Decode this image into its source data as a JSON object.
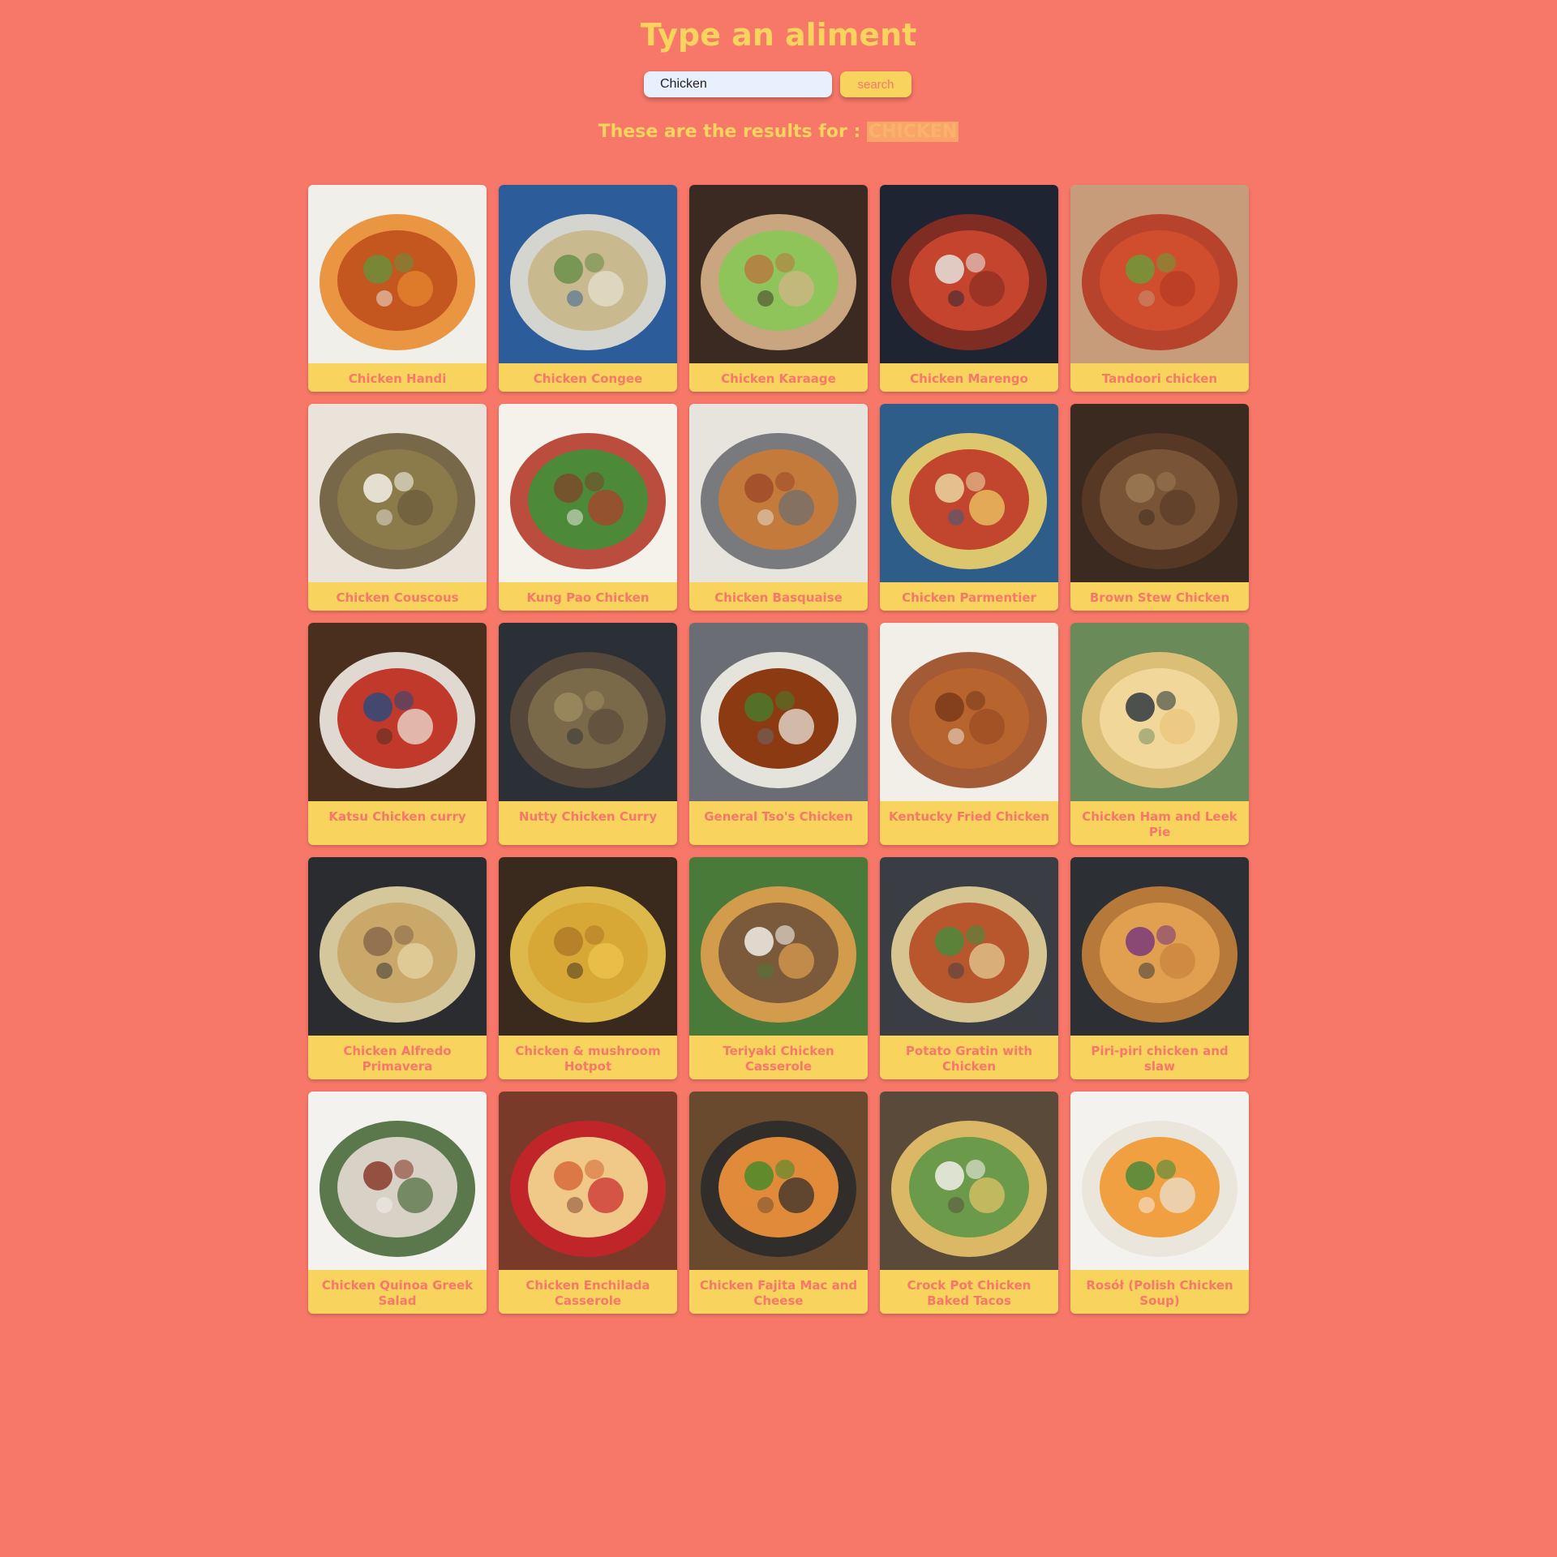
{
  "header": {
    "title": "Type an aliment"
  },
  "search": {
    "value": "Chicken",
    "button_label": "search"
  },
  "results": {
    "label": "These are the results for :",
    "term": "CHICKEN"
  },
  "colors": {
    "background": "#f77869",
    "accent": "#f8d35e"
  },
  "recipes": [
    {
      "title": "Chicken Handi"
    },
    {
      "title": "Chicken Congee"
    },
    {
      "title": "Chicken Karaage"
    },
    {
      "title": "Chicken Marengo"
    },
    {
      "title": "Tandoori chicken"
    },
    {
      "title": "Chicken Couscous"
    },
    {
      "title": "Kung Pao Chicken"
    },
    {
      "title": "Chicken Basquaise"
    },
    {
      "title": "Chicken Parmentier"
    },
    {
      "title": "Brown Stew Chicken"
    },
    {
      "title": "Katsu Chicken curry"
    },
    {
      "title": "Nutty Chicken Curry"
    },
    {
      "title": "General Tso's Chicken"
    },
    {
      "title": "Kentucky Fried Chicken"
    },
    {
      "title": "Chicken Ham and Leek Pie"
    },
    {
      "title": "Chicken Alfredo Primavera"
    },
    {
      "title": "Chicken & mushroom Hotpot"
    },
    {
      "title": "Teriyaki Chicken Casserole"
    },
    {
      "title": "Potato Gratin with Chicken"
    },
    {
      "title": "Piri-piri chicken and slaw"
    },
    {
      "title": "Chicken Quinoa Greek Salad"
    },
    {
      "title": "Chicken Enchilada Casserole"
    },
    {
      "title": "Chicken Fajita Mac and Cheese"
    },
    {
      "title": "Crock Pot Chicken Baked Tacos"
    },
    {
      "title": "Rosół (Polish Chicken Soup)"
    }
  ]
}
